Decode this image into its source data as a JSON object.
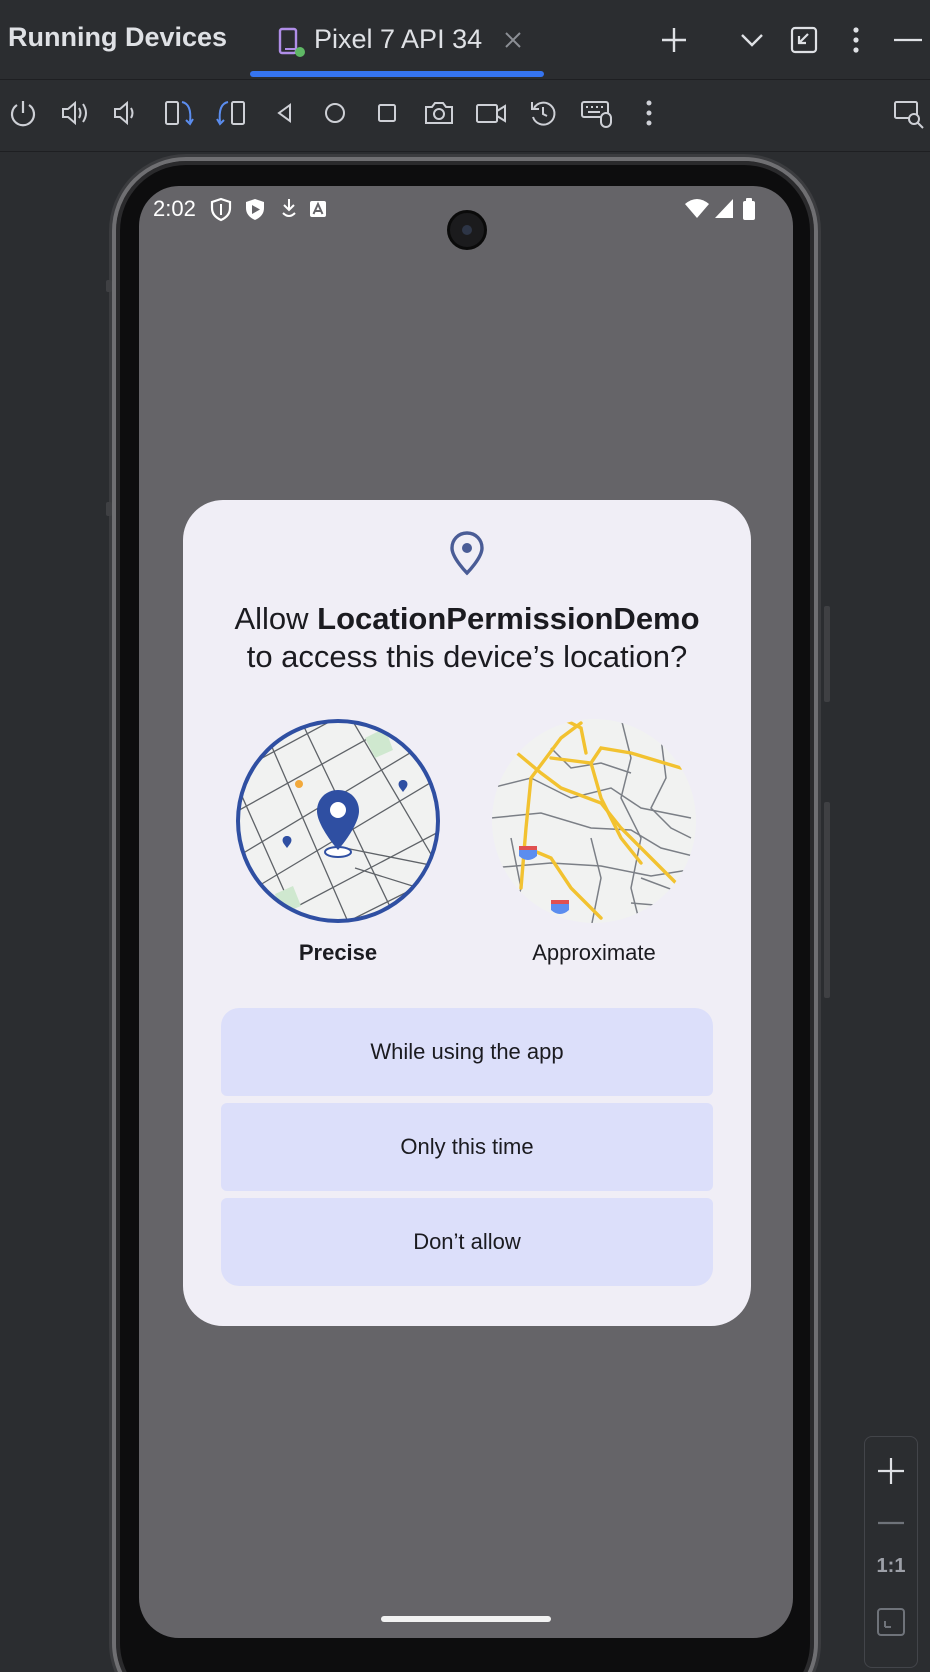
{
  "header": {
    "panel_title": "Running Devices",
    "device_tab_label": "Pixel 7 API 34",
    "accent_color": "#3574f0"
  },
  "toolbar": {
    "icons": [
      "power-icon",
      "volume-up-icon",
      "volume-down-icon",
      "rotate-left-icon",
      "rotate-right-icon",
      "back-icon",
      "home-icon",
      "overview-icon",
      "screenshot-icon",
      "screen-record-icon",
      "reset-icon",
      "keyboard-mouse-icon",
      "more-icon",
      "device-explorer-icon"
    ]
  },
  "status_bar": {
    "time": "2:02"
  },
  "dialog": {
    "title_prefix": "Allow ",
    "app_name": "LocationPermissionDemo",
    "title_suffix": "to access this device’s location?",
    "precise_label": "Precise",
    "approximate_label": "Approximate",
    "selected_option": "Precise",
    "buttons": {
      "while_using": "While using the app",
      "only_this_time": "Only this time",
      "dont_allow": "Don’t allow"
    },
    "colors": {
      "dialog_bg": "#f0eef6",
      "button_bg": "#dcdffa",
      "precise_ring": "#2f4fa2",
      "approx_roads": "#f2c230"
    }
  },
  "zoom": {
    "actual_size_label": "1:1"
  }
}
